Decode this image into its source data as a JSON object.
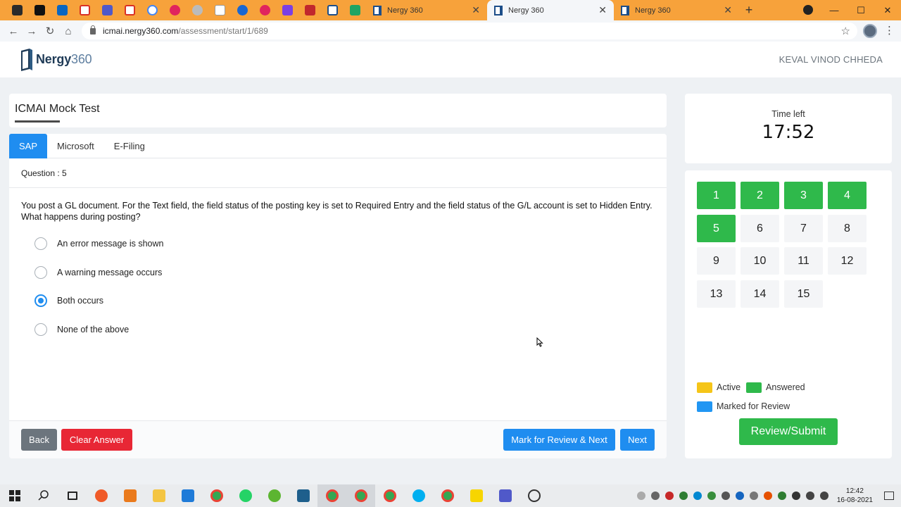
{
  "browser": {
    "tabs": [
      {
        "title": "Nergy 360",
        "active": false
      },
      {
        "title": "Nergy 360",
        "active": true
      },
      {
        "title": "Nergy 360",
        "active": false
      }
    ],
    "url_host": "icmai.nergy360.com",
    "url_path": "/assessment/start/1/689"
  },
  "header": {
    "logo_brand": "Nergy",
    "logo_num": "360",
    "user_name": "KEVAL VINOD CHHEDA"
  },
  "test": {
    "title": "ICMAI Mock Test"
  },
  "sections": [
    {
      "label": "SAP",
      "active": true
    },
    {
      "label": "Microsoft",
      "active": false
    },
    {
      "label": "E-Filing",
      "active": false
    }
  ],
  "question": {
    "number_label": "Question : 5",
    "text": "You post a GL document. For the Text field, the field status of the posting key is set to Required Entry and the field status of the G/L account is set to Hidden Entry. What happens during posting?",
    "options": [
      {
        "label": "An error message is shown",
        "selected": false
      },
      {
        "label": "A warning message occurs",
        "selected": false
      },
      {
        "label": "Both occurs",
        "selected": true
      },
      {
        "label": "None of the above",
        "selected": false
      }
    ]
  },
  "actions": {
    "back": "Back",
    "clear": "Clear Answer",
    "mark_review": "Mark for Review & Next",
    "next": "Next",
    "submit": "Review/Submit"
  },
  "timer": {
    "label": "Time left",
    "value": "17:52"
  },
  "palette": [
    {
      "n": "1",
      "status": "answered"
    },
    {
      "n": "2",
      "status": "answered"
    },
    {
      "n": "3",
      "status": "answered"
    },
    {
      "n": "4",
      "status": "answered"
    },
    {
      "n": "5",
      "status": "answered"
    },
    {
      "n": "6",
      "status": "none"
    },
    {
      "n": "7",
      "status": "none"
    },
    {
      "n": "8",
      "status": "none"
    },
    {
      "n": "9",
      "status": "none"
    },
    {
      "n": "10",
      "status": "none"
    },
    {
      "n": "11",
      "status": "none"
    },
    {
      "n": "12",
      "status": "none"
    },
    {
      "n": "13",
      "status": "none"
    },
    {
      "n": "14",
      "status": "none"
    },
    {
      "n": "15",
      "status": "none"
    }
  ],
  "legend": {
    "active": "Active",
    "answered": "Answered",
    "review": "Marked for Review"
  },
  "colors": {
    "primary": "#1f8df0",
    "answered": "#2fb94b",
    "active": "#f5c518",
    "review": "#2196f3",
    "danger": "#e82735",
    "secondary": "#6c757d",
    "browser_tabbar": "#f7a23b"
  },
  "taskbar": {
    "time": "12:42",
    "date": "16-08-2021"
  }
}
